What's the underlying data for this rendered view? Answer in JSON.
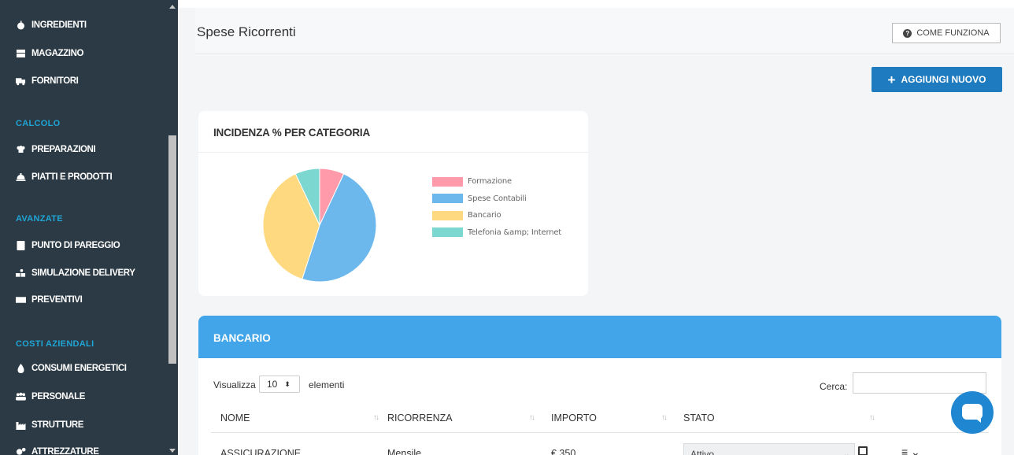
{
  "sidebar": {
    "items": [
      {
        "label": "INGREDIENTI",
        "icon": "apple-icon"
      },
      {
        "label": "MAGAZZINO",
        "icon": "boxes-icon"
      },
      {
        "label": "FORNITORI",
        "icon": "truck-icon"
      },
      {
        "label": "PREPARAZIONI",
        "icon": "chef-hat-icon"
      },
      {
        "label": "PIATTI E PRODOTTI",
        "icon": "cloche-icon"
      },
      {
        "label": "PUNTO DI PAREGGIO",
        "icon": "calculator-icon"
      },
      {
        "label": "SIMULAZIONE DELIVERY",
        "icon": "delivery-icon"
      },
      {
        "label": "PREVENTIVI",
        "icon": "money-icon"
      },
      {
        "label": "CONSUMI ENERGETICI",
        "icon": "flame-icon"
      },
      {
        "label": "PERSONALE",
        "icon": "users-icon"
      },
      {
        "label": "STRUTTURE",
        "icon": "industry-icon"
      },
      {
        "label": "ATTREZZATURE",
        "icon": "cogs-icon"
      }
    ],
    "sections": [
      "CALCOLO",
      "AVANZATE",
      "COSTI AZIENDALI"
    ]
  },
  "header": {
    "title": "Spese Ricorrenti",
    "how_label": "COME FUNZIONA"
  },
  "toolbar": {
    "add_label": "AGGIUNGI NUOVO"
  },
  "chart_card": {
    "title": "INCIDENZA % PER CATEGORIA"
  },
  "chart_data": {
    "type": "pie",
    "title": "INCIDENZA % PER CATEGORIA",
    "legend_position": "right",
    "series": [
      {
        "name": "Formazione",
        "value": 7,
        "color": "#ff9aab"
      },
      {
        "name": "Spese Contabili",
        "value": 48,
        "color": "#6cb8ec"
      },
      {
        "name": "Bancario",
        "value": 38,
        "color": "#ffd97f"
      },
      {
        "name": "Telefonia &amp; Internet",
        "value": 7,
        "color": "#7dd7d1"
      }
    ]
  },
  "table_card": {
    "title": "BANCARIO",
    "show_label": "Visualizza",
    "show_value": "10",
    "show_after": "elementi",
    "search_label": "Cerca:",
    "columns": [
      "NOME",
      "RICORRENZA",
      "IMPORTO",
      "STATO"
    ],
    "rows": [
      {
        "nome": "ASSICURAZIONE",
        "ricorrenza": "Mensile",
        "importo": "€ 350",
        "stato": "Attivo"
      }
    ]
  },
  "colors": {
    "sidebar_bg": "#2b3a44",
    "section_heading": "#1fa5d6",
    "primary_button": "#1f7bbf",
    "table_header": "#42a5ea",
    "chat_button": "#1f86d2"
  }
}
